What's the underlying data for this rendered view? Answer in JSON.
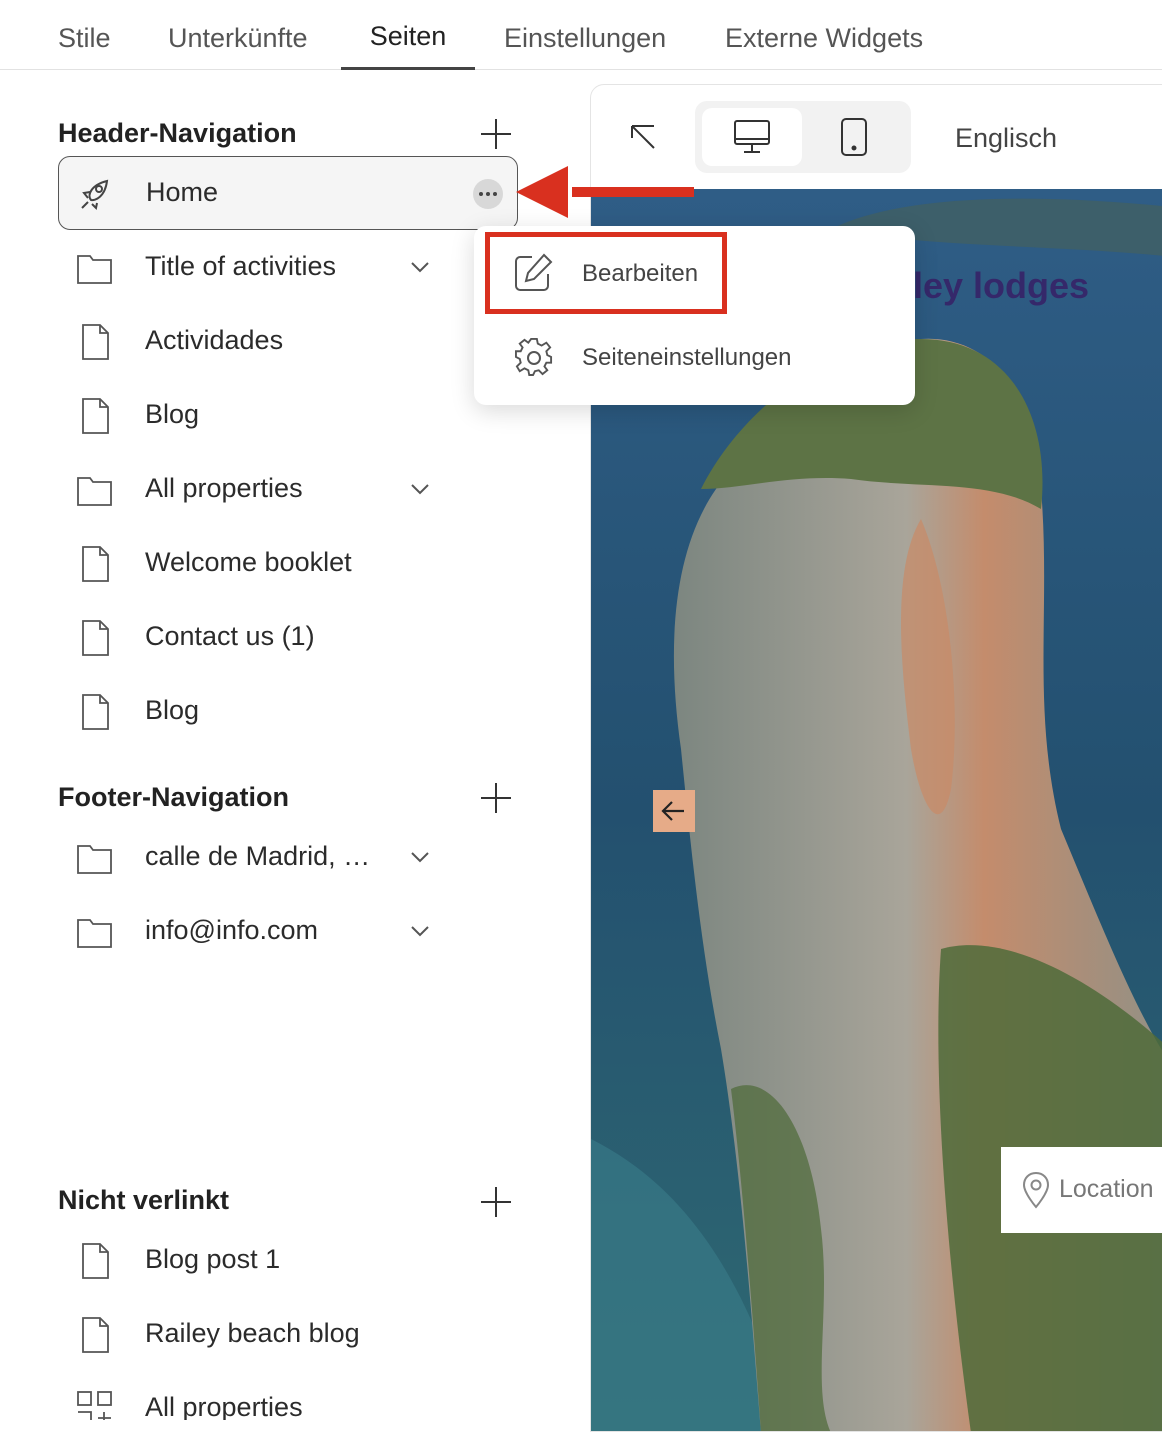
{
  "tabs": [
    {
      "label": "Stile"
    },
    {
      "label": "Unterkünfte"
    },
    {
      "label": "Seiten"
    },
    {
      "label": "Einstellungen"
    },
    {
      "label": "Externe Widgets"
    }
  ],
  "active_tab": "Seiten",
  "header_nav": {
    "title": "Header-Navigation",
    "items": [
      {
        "label": "Home",
        "icon": "rocket-icon",
        "selected": true
      },
      {
        "label": "Title of activities",
        "icon": "folder-icon",
        "expandable": true
      },
      {
        "label": "Actividades",
        "icon": "page-icon"
      },
      {
        "label": "Blog",
        "icon": "page-icon"
      },
      {
        "label": "All properties",
        "icon": "folder-icon",
        "expandable": true
      },
      {
        "label": "Welcome booklet",
        "icon": "page-icon"
      },
      {
        "label": "Contact us (1)",
        "icon": "page-icon"
      },
      {
        "label": "Blog",
        "icon": "page-icon"
      }
    ]
  },
  "footer_nav": {
    "title": "Footer-Navigation",
    "items": [
      {
        "label": "calle de Madrid, …",
        "icon": "folder-icon",
        "expandable": true
      },
      {
        "label": "info@info.com",
        "icon": "folder-icon",
        "expandable": true
      }
    ]
  },
  "unlinked": {
    "title": "Nicht verlinkt",
    "items": [
      {
        "label": "Blog post 1",
        "icon": "page-icon"
      },
      {
        "label": "Railey beach blog",
        "icon": "page-icon"
      },
      {
        "label": "All properties",
        "icon": "grid-icon"
      }
    ]
  },
  "context_menu": {
    "items": [
      {
        "label": "Bearbeiten",
        "icon": "edit-icon",
        "highlighted": true
      },
      {
        "label": "Seiteneinstellungen",
        "icon": "gear-icon"
      }
    ]
  },
  "preview": {
    "language": "Englisch",
    "site_title_fragment": "iley lodges",
    "location_label": "Location",
    "active_device": "desktop"
  },
  "colors": {
    "annotation_red": "#d9301f",
    "site_title": "#35286a",
    "arrow_button": "#e6ab88"
  }
}
